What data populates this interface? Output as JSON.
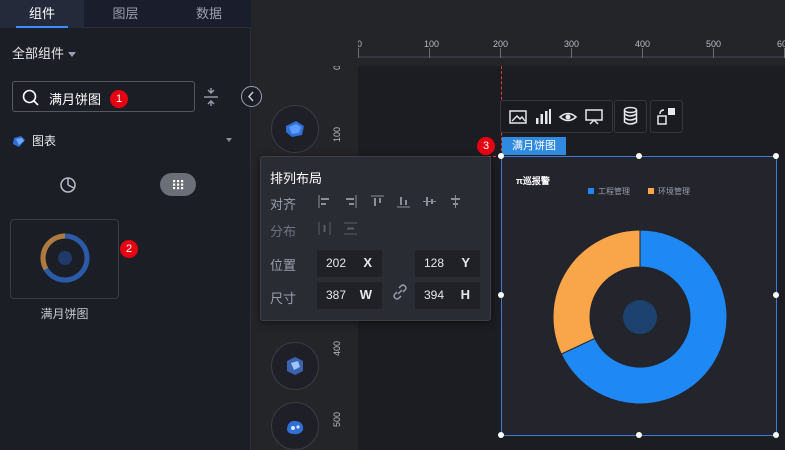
{
  "tabs": [
    {
      "label": "组件",
      "active": true
    },
    {
      "label": "图层",
      "active": false
    },
    {
      "label": "数据",
      "active": false
    }
  ],
  "left_panel": {
    "all_components_label": "全部组件",
    "search_value": "满月饼图",
    "category_label": "图表",
    "component_name": "满月饼图"
  },
  "badges": {
    "one": "1",
    "two": "2",
    "three": "3"
  },
  "ruler": {
    "h_labels": [
      "0",
      "100",
      "200",
      "300",
      "400",
      "500",
      "600"
    ],
    "v_labels": [
      "0",
      "100",
      "400",
      "500"
    ]
  },
  "toolbar": {
    "icons": [
      "image-icon",
      "bar-chart-icon",
      "eye-icon",
      "screen-icon",
      "database-icon",
      "shape-swap-icon"
    ]
  },
  "layout_popup": {
    "title": "排列布局",
    "align_label": "对齐",
    "distribute_label": "分布",
    "position_label": "位置",
    "size_label": "尺寸",
    "x_value": "202",
    "x_axis": "X",
    "y_value": "128",
    "y_axis": "Y",
    "w_value": "387",
    "w_axis": "W",
    "h_value": "394",
    "h_axis": "H"
  },
  "component": {
    "tag_label": "满月饼图"
  },
  "chart_data": {
    "type": "pie",
    "title": "π巡报警",
    "legend_position": "top-center",
    "series": [
      {
        "name": "工程管理",
        "value": 68,
        "color": "#1e88f5"
      },
      {
        "name": "环境管理",
        "value": 32,
        "color": "#f9a64a"
      }
    ]
  },
  "colors": {
    "accent": "#3c8cff",
    "badge": "#e60012",
    "guide": "#e23b3b",
    "tag": "#2f8ae0"
  }
}
